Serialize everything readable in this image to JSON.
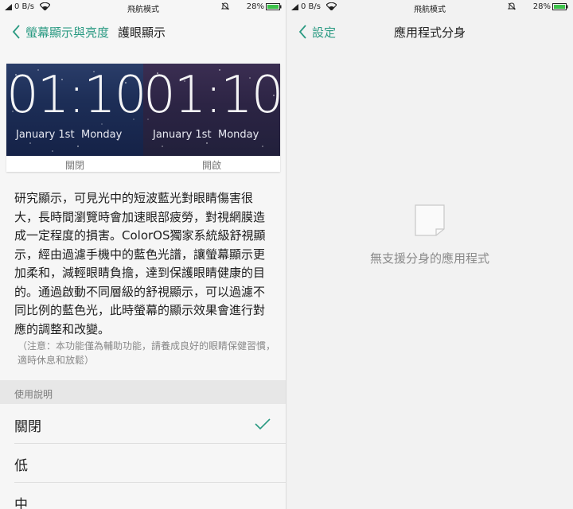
{
  "status_bar": {
    "speed": "0 B/s",
    "mode": "飛航模式",
    "battery": "28%"
  },
  "left_screen": {
    "back_label": "螢幕顯示與亮度",
    "title": "護眼顯示",
    "preview": {
      "off": {
        "time": "01:10",
        "date": "January 1st",
        "day": "Monday",
        "label": "關閉"
      },
      "on": {
        "time": "01:10",
        "date": "January 1st",
        "day": "Monday",
        "label": "開啟"
      }
    },
    "description": "研究顯示，可見光中的短波藍光對眼睛傷害很大，長時間瀏覽時會加速眼部疲勞，對視網膜造成一定程度的損害。ColorOS獨家系統級舒視顯示，經由過濾手機中的藍色光譜，讓螢幕顯示更加柔和，減輕眼睛負擔，達到保護眼睛健康的目的。通過啟動不同層級的舒視顯示，可以過濾不同比例的藍色光，此時螢幕的顯示效果會進行對應的調整和改變。",
    "note": "（注意：本功能僅為輔助功能，請養成良好的眼睛保健習慣，適時休息和放鬆）",
    "section_header": "使用說明",
    "options": [
      {
        "label": "關閉",
        "selected": true
      },
      {
        "label": "低",
        "selected": false
      },
      {
        "label": "中",
        "selected": false
      }
    ]
  },
  "right_screen": {
    "back_label": "設定",
    "title": "應用程式分身",
    "empty_message": "無支援分身的應用程式"
  },
  "colors": {
    "accent": "#2a9a82",
    "battery": "#3cc24a"
  }
}
